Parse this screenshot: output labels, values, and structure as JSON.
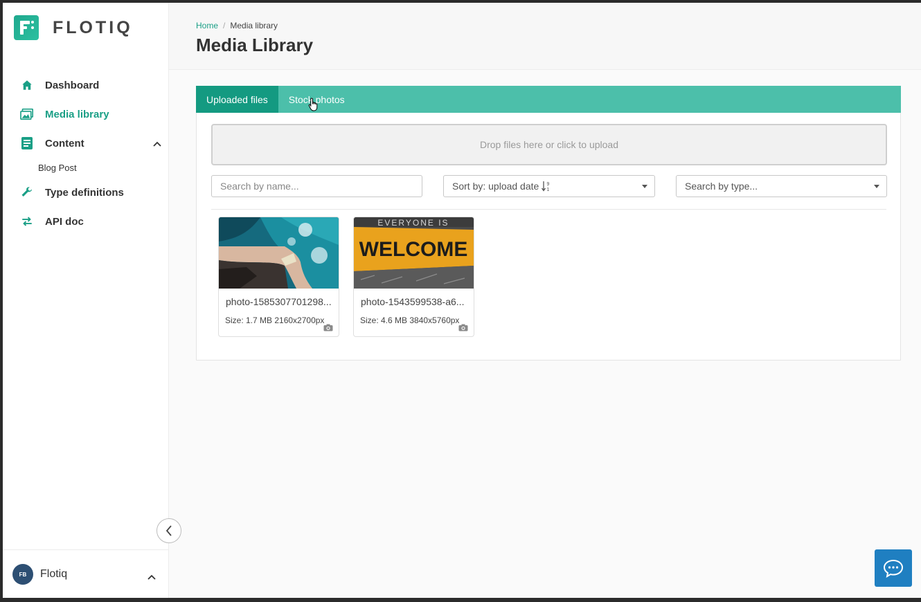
{
  "app": {
    "logo_text": "FLOTIQ",
    "accent": "#1a9f86",
    "brand_dark": "#149a81",
    "tab_bar": "#4cbfaa"
  },
  "sidebar": {
    "items": [
      {
        "label": "Dashboard",
        "icon": "home-icon"
      },
      {
        "label": "Media library",
        "icon": "image-gallery-icon",
        "active": true
      },
      {
        "label": "Content",
        "icon": "document-list-icon",
        "expanded": true
      },
      {
        "label": "Type definitions",
        "icon": "wrench-icon"
      },
      {
        "label": "API doc",
        "icon": "swap-arrows-icon"
      }
    ],
    "content_sub": [
      {
        "label": "Blog Post"
      }
    ],
    "user": {
      "initials": "FB",
      "name": "Flotiq"
    }
  },
  "header": {
    "breadcrumb": {
      "home": "Home",
      "separator": "/",
      "current": "Media library"
    },
    "title": "Media Library"
  },
  "tabs": [
    {
      "label": "Uploaded files",
      "active": true
    },
    {
      "label": "Stock photos",
      "active": false
    }
  ],
  "upload": {
    "dropzone_text": "Drop files here or click to upload"
  },
  "filters": {
    "search_placeholder": "Search by name...",
    "sort_label": "Sort by: upload date",
    "type_placeholder": "Search by type..."
  },
  "files": [
    {
      "name": "photo-1585307701298...",
      "size": "Size: 1.7 MB 2160x2700px",
      "thumb": "aerial coastline"
    },
    {
      "name": "photo-1543599538-a6...",
      "size": "Size: 4.6 MB 3840x5760px",
      "thumb_top": "EVERYONE IS",
      "thumb_text": "WELCOME"
    }
  ]
}
